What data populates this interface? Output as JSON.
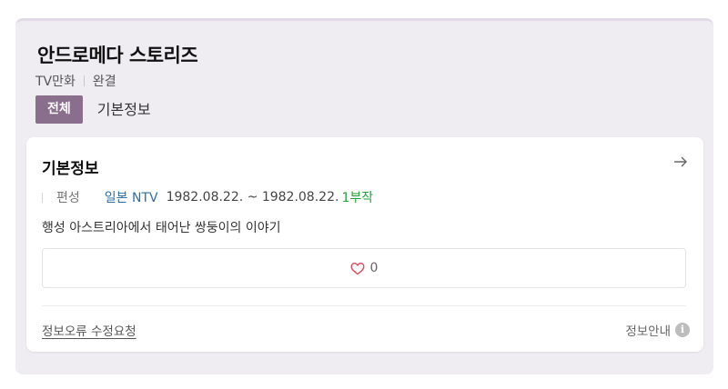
{
  "header": {
    "title": "안드로메다 스토리즈",
    "category": "TV만화",
    "status": "완결"
  },
  "tabs": [
    {
      "label": "전체",
      "active": true
    },
    {
      "label": "기본정보",
      "active": false
    }
  ],
  "basic_info": {
    "title": "기본정보",
    "arrow_icon": "arrow-right-icon",
    "broadcast_label": "편성",
    "network": "일본 NTV",
    "date_range": "1982.08.22. ~ 1982.08.22.",
    "episodes": "1부작",
    "description": "행성 아스트리아에서 태어난 쌍둥이의 이야기",
    "like_count": "0",
    "report_link": "정보오류 수정요청",
    "info_guide": "정보안내",
    "info_icon_glyph": "i"
  },
  "colors": {
    "accent": "#8a6f8c",
    "network": "#2d6fa6",
    "episodes": "#23a23a",
    "heart": "#e0495b"
  }
}
